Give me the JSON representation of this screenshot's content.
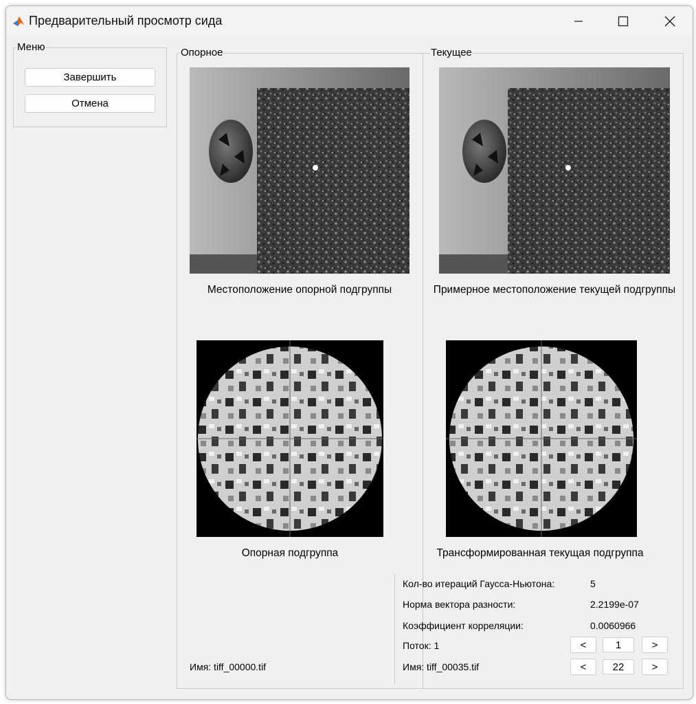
{
  "window": {
    "title": "Предварительный просмотр сида"
  },
  "menu": {
    "label": "Меню",
    "finish_button": "Завершить",
    "cancel_button": "Отмена"
  },
  "reference": {
    "label": "Опорное",
    "location_caption": "Местоположение опорной подгруппы",
    "subset_caption": "Опорная подгруппа",
    "file_name": "Имя: tiff_00000.tif"
  },
  "current": {
    "label": "Текущее",
    "location_caption": "Примерное местоположение текущей подгруппы",
    "subset_caption": "Трансформированная текущая подгруппа"
  },
  "stats": {
    "iterations_label": "Кол-во итераций Гаусса-Ньютона:",
    "iterations_value": "5",
    "diff_norm_label": "Норма вектора разности:",
    "diff_norm_value": "2.2199e-07",
    "corr_label": "Коэффициент корреляции:",
    "corr_value": "0.0060966",
    "thread_label": "Поток: 1",
    "thread_value": "1",
    "file_label": "Имя: tiff_00035.tif",
    "file_value": "22",
    "prev_symbol": "<",
    "next_symbol": ">"
  },
  "colors": {
    "window_bg": "#f0f0f0",
    "border": "#c9c9c9"
  }
}
